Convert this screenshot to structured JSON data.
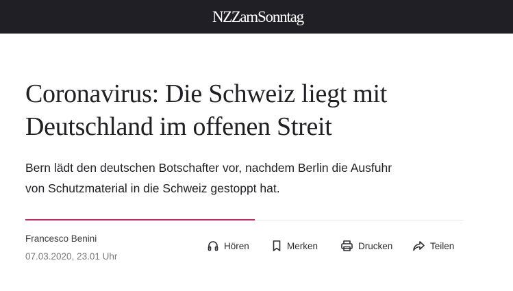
{
  "header": {
    "logo": {
      "nzz": "NZZ",
      "rest": "amSonntag"
    }
  },
  "article": {
    "headline_line1": "Coronavirus: Die Schweiz liegt mit",
    "headline_line2": "Deutschland im offenen Streit",
    "lead_line1": "Bern lädt den deutschen Botschafter vor, nachdem Berlin die Ausfuhr",
    "lead_line2": "von Schutzmaterial in die Schweiz gestoppt hat.",
    "author": "Francesco Benini",
    "date": "07.03.2020, 23.01 Uhr"
  },
  "actions": [
    {
      "label": "Hören",
      "icon": "headphones-icon"
    },
    {
      "label": "Merken",
      "icon": "bookmark-icon"
    },
    {
      "label": "Drucken",
      "icon": "printer-icon"
    },
    {
      "label": "Teilen",
      "icon": "share-arrow-icon"
    }
  ],
  "colors": {
    "topbar": "#1f1f25",
    "accent": "#d4235c",
    "text": "#1f1f24",
    "muted": "#7a7a80"
  }
}
